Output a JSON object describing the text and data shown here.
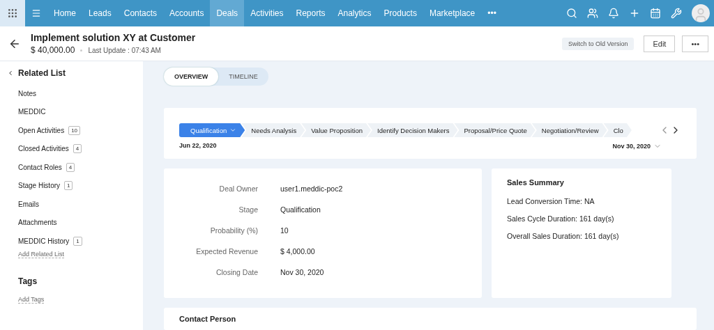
{
  "nav": {
    "items": [
      {
        "label": "Home",
        "selected": false
      },
      {
        "label": "Leads",
        "selected": false
      },
      {
        "label": "Contacts",
        "selected": false
      },
      {
        "label": "Accounts",
        "selected": false
      },
      {
        "label": "Deals",
        "selected": true
      },
      {
        "label": "Activities",
        "selected": false
      },
      {
        "label": "Reports",
        "selected": false
      },
      {
        "label": "Analytics",
        "selected": false
      },
      {
        "label": "Products",
        "selected": false
      },
      {
        "label": "Marketplace",
        "selected": false
      }
    ],
    "more": "•••"
  },
  "header": {
    "title": "Implement solution XY at Customer",
    "amount": "$ 40,000.00",
    "last_update": "Last Update : 07:43 AM",
    "switch_button": "Switch to Old Version",
    "edit_button": "Edit",
    "more_button": "•••"
  },
  "sidebar": {
    "title": "Related List",
    "items": [
      {
        "label": "Notes"
      },
      {
        "label": "MEDDIC"
      },
      {
        "label": "Open Activities",
        "count": "10"
      },
      {
        "label": "Closed Activities",
        "count": "4"
      },
      {
        "label": "Contact Roles",
        "count": "4"
      },
      {
        "label": "Stage History",
        "count": "1"
      },
      {
        "label": "Emails"
      },
      {
        "label": "Attachments"
      },
      {
        "label": "MEDDIC History",
        "count": "1"
      }
    ],
    "add_link": "Add Related List",
    "tags_title": "Tags",
    "add_tags": "Add Tags"
  },
  "view_tabs": [
    {
      "label": "OVERVIEW",
      "selected": true
    },
    {
      "label": "TIMELINE",
      "selected": false
    }
  ],
  "stages": {
    "items": [
      {
        "label": "Qualification",
        "selected": true
      },
      {
        "label": "Needs Analysis",
        "selected": false
      },
      {
        "label": "Value Proposition",
        "selected": false
      },
      {
        "label": "Identify Decision Makers",
        "selected": false
      },
      {
        "label": "Proposal/Price Quote",
        "selected": false
      },
      {
        "label": "Negotiation/Review",
        "selected": false
      },
      {
        "label": "Clo",
        "selected": false
      }
    ],
    "start_date": "Jun 22, 2020",
    "end_date": "Nov 30, 2020"
  },
  "details": [
    {
      "label": "Deal Owner",
      "value": "user1.meddic-poc2"
    },
    {
      "label": "Stage",
      "value": "Qualification"
    },
    {
      "label": "Probability (%)",
      "value": "10"
    },
    {
      "label": "Expected Revenue",
      "value": "$ 4,000.00"
    },
    {
      "label": "Closing Date",
      "value": "Nov 30, 2020"
    }
  ],
  "sales_summary": {
    "title": "Sales Summary",
    "lines": [
      "Lead Conversion Time: NA",
      "Sales Cycle Duration: 161 day(s)",
      "Overall Sales Duration: 161 day(s)"
    ]
  },
  "contact_section": {
    "title": "Contact Person"
  }
}
